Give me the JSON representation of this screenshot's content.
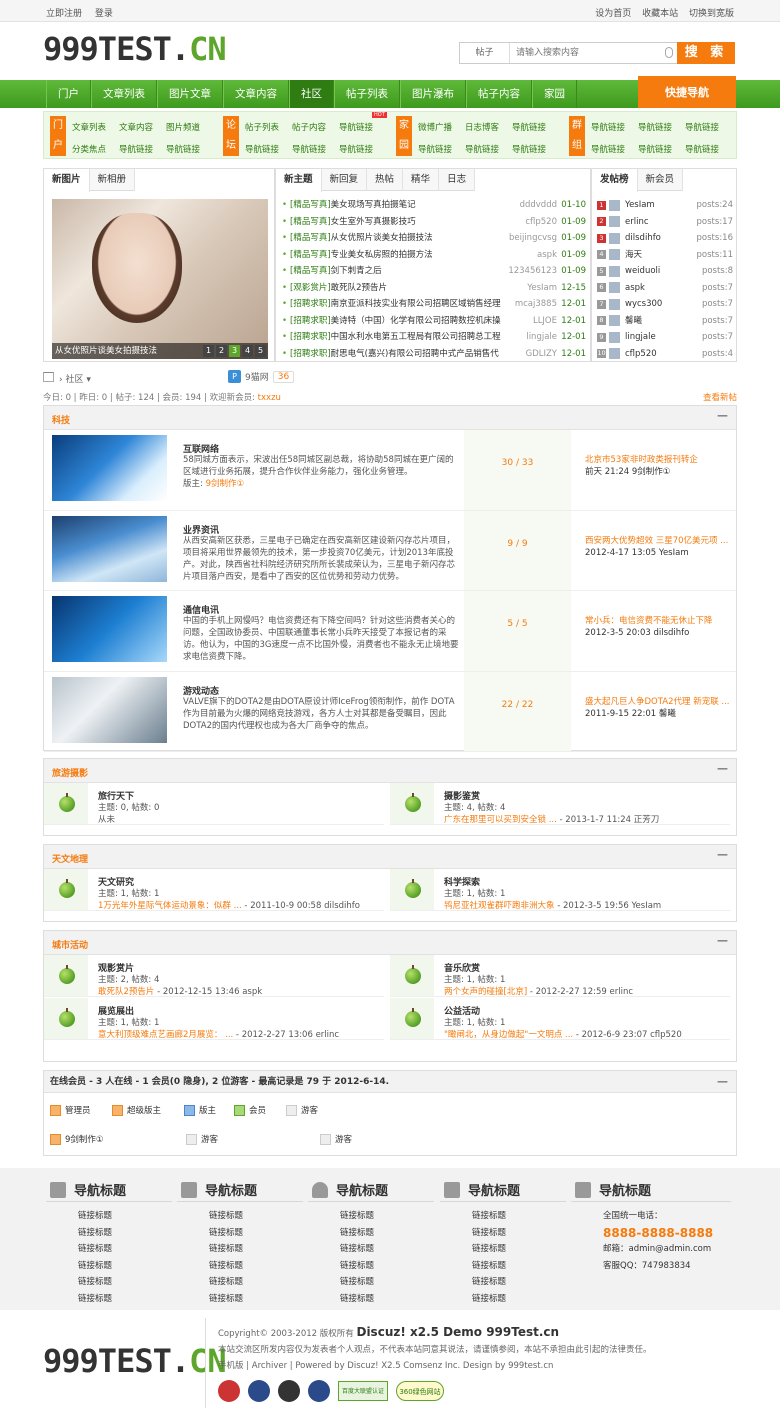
{
  "topbar": {
    "register": "立即注册",
    "login": "登录",
    "right": [
      "设为首页",
      "收藏本站",
      "切换到宽版"
    ]
  },
  "logo": {
    "text": "999TEST.",
    "suffix": "CN"
  },
  "search": {
    "select": "帖子",
    "placeholder": "请输入搜索内容",
    "button": "搜 索"
  },
  "nav": {
    "items": [
      "门户",
      "文章列表",
      "图片文章",
      "文章内容",
      "社区",
      "帖子列表",
      "图片瀑布",
      "帖子内容",
      "家园"
    ],
    "active": "社区",
    "quick": "快捷导航"
  },
  "subnav": [
    {
      "tag": "门户",
      "links": [
        "文章列表",
        "文章内容",
        "图片频道",
        "分类焦点",
        "导航链接",
        "导航链接"
      ]
    },
    {
      "tag": "论坛",
      "links": [
        "帖子列表",
        "帖子内容",
        "导航链接",
        "导航链接",
        "导航链接",
        "导航链接"
      ]
    },
    {
      "tag": "家园",
      "links": [
        "微博广播",
        "日志博客",
        "导航链接",
        "导航链接",
        "导航链接",
        "导航链接"
      ]
    },
    {
      "tag": "群组",
      "links": [
        "导航链接",
        "导航链接",
        "导航链接",
        "导航链接",
        "导航链接",
        "导航链接"
      ]
    }
  ],
  "hot": "HOT",
  "panel1": {
    "tabs": [
      "新图片",
      "新相册"
    ],
    "caption": "从女优照片谈美女拍摄技法",
    "nums": [
      "1",
      "2",
      "3",
      "4",
      "5"
    ]
  },
  "panel2": {
    "tabs": [
      "新主题",
      "新回复",
      "热帖",
      "精华",
      "日志"
    ],
    "topics": [
      {
        "cat": "[精品写真]",
        "title": "美女现场写真拍摄笔记",
        "author": "dddvddd",
        "date": "01-10"
      },
      {
        "cat": "[精品写真]",
        "title": "女生室外写真摄影技巧",
        "author": "cflp520",
        "date": "01-09"
      },
      {
        "cat": "[精品写真]",
        "title": "从女优照片谈美女拍摄技法",
        "author": "beijingcvsg",
        "date": "01-09"
      },
      {
        "cat": "[精品写真]",
        "title": "专业美女私房照的拍摄方法",
        "author": "aspk",
        "date": "01-09"
      },
      {
        "cat": "[精品写真]",
        "title": "剑下刺青之后",
        "author": "123456123",
        "date": "01-09"
      },
      {
        "cat": "[观影赏片]",
        "title": "敢死队2预告片",
        "author": "YesIam",
        "date": "12-15"
      },
      {
        "cat": "[招聘求职]",
        "title": "南京亚派科技实业有限公司招聘区域销售经理",
        "author": "mcaj3885",
        "date": "12-01"
      },
      {
        "cat": "[招聘求职]",
        "title": "美诗特（中国）化学有限公司招聘数控机床操",
        "author": "LLJOE",
        "date": "12-01"
      },
      {
        "cat": "[招聘求职]",
        "title": "中国水利水电第五工程局有限公司招聘总工程",
        "author": "lingjale",
        "date": "12-01"
      },
      {
        "cat": "[招聘求职]",
        "title": "耐思电气(嘉兴)有限公司招聘中式产品销售代",
        "author": "GDLIZY",
        "date": "12-01"
      }
    ]
  },
  "panel3": {
    "tabs": [
      "发帖榜",
      "新会员"
    ],
    "rank": [
      {
        "no": "1",
        "name": "YesIam",
        "posts": "posts:24"
      },
      {
        "no": "2",
        "name": "erlinc",
        "posts": "posts:17"
      },
      {
        "no": "3",
        "name": "dilsdihfo",
        "posts": "posts:16"
      },
      {
        "no": "4",
        "name": "海天",
        "posts": "posts:11"
      },
      {
        "no": "5",
        "name": "weiduoli",
        "posts": "posts:8"
      },
      {
        "no": "6",
        "name": "aspk",
        "posts": "posts:7"
      },
      {
        "no": "7",
        "name": "wycs300",
        "posts": "posts:7"
      },
      {
        "no": "8",
        "name": "馨曦",
        "posts": "posts:7"
      },
      {
        "no": "9",
        "name": "lingjale",
        "posts": "posts:7"
      },
      {
        "no": "10",
        "name": "cflp520",
        "posts": "posts:4"
      }
    ]
  },
  "crumb": {
    "path": "› 社区 ▾",
    "site": "9猫网",
    "count": "36"
  },
  "stats": {
    "text": "今日: 0 | 昨日: 0 | 帖子: 124 | 会员: 194 | 欢迎新会员: ",
    "user": "txxzu",
    "newpost": "查看新帖"
  },
  "sec1": {
    "title": "科技",
    "rows": [
      {
        "name": "互联网络",
        "desc": "58同城方面表示，宋波出任58同城区副总裁，将协助58同城在更广阔的区域进行业务拓展，提升合作伙伴业务能力，强化业务管理。",
        "mod": "版主: ",
        "modname": "9剑制作①",
        "count": "30 / 33",
        "lasttitle": "北京市53家非时政类报刊转企",
        "lastinfo": "前天 21:24 9剑制作①"
      },
      {
        "name": "业界资讯",
        "desc": "从西安高新区获悉，三星电子已确定在西安高新区建设新闪存芯片项目，项目将采用世界最领先的技术，第一步投资70亿美元，计划2013年底投产。对此，陕西省社科院经济研究所所长裴成荣认为，三星电子新闪存芯片项目落户西安，是看中了西安的区位优势和劳动力优势。",
        "mod": "",
        "modname": "",
        "count": "9 / 9",
        "lasttitle": "西安两大优势超效 三星70亿美元项 ...",
        "lastinfo": "2012-4-17 13:05 YesIam"
      },
      {
        "name": "通信电讯",
        "desc": "中国的手机上网慢吗？电信资费还有下降空间吗？针对这些消费者关心的问题，全国政协委员、中国联通董事长常小兵昨天接受了本报记者的采访。他认为，中国的3G速度一点不比国外慢，消费者也不能永无止境地要求电信资费下降。",
        "mod": "",
        "modname": "",
        "count": "5 / 5",
        "lasttitle": "常小兵：电信资费不能无休止下降",
        "lastinfo": "2012-3-5 20:03 dilsdihfo"
      },
      {
        "name": "游戏动态",
        "desc": "VALVE旗下的DOTA2是由DOTA原设计师IceFrog领衔制作，前作 DOTA作为目前最为火爆的网络竞技游戏，各方人士对其都是备受瞩目，因此DOTA2的国内代理权也成为各大厂商争夺的焦点。",
        "mod": "",
        "modname": "",
        "count": "22 / 22",
        "lasttitle": "盛大起凡巨人争DOTA2代理 新宠联 ...",
        "lastinfo": "2011-9-15 22:01 馨曦"
      }
    ]
  },
  "sec2": {
    "title": "旅游摄影",
    "cards": [
      {
        "name": "旅行天下",
        "stat": "主题: 0, 帖数: 0",
        "lasttitle": "",
        "lastinfo": "从未"
      },
      {
        "name": "摄影鉴赏",
        "stat": "主题: 4, 帖数: 4",
        "lasttitle": "广东在那里可以买到安全锁 ...",
        "lastinfo": " - 2013-1-7 11:24 正芳刀"
      }
    ]
  },
  "sec3": {
    "title": "天文地理",
    "cards": [
      {
        "name": "天文研究",
        "stat": "主题: 1, 帖数: 1",
        "lasttitle": "1万光年外星际气体运动景象：似群 ...",
        "lastinfo": " - 2011-10-9 00:58 dilsdihfo"
      },
      {
        "name": "科学探索",
        "stat": "主题: 1, 帖数: 1",
        "lasttitle": "鸨尼亚社观雀群吓跑非洲大象",
        "lastinfo": " - 2012-3-5 19:56 YesIam"
      }
    ]
  },
  "sec4": {
    "title": "城市活动",
    "cards": [
      {
        "name": "观影赏片",
        "stat": "主题: 2, 帖数: 4",
        "lasttitle": "敢死队2预告片",
        "lastinfo": " - 2012-12-15 13:46 aspk"
      },
      {
        "name": "音乐欣赏",
        "stat": "主题: 1, 帖数: 1",
        "lasttitle": "两个女声的碰撞[北京]",
        "lastinfo": " - 2012-2-27 12:59 erlinc"
      },
      {
        "name": "展览展出",
        "stat": "主题: 1, 帖数: 1",
        "lasttitle": "意大利顶级难点艺画廊2月展览： ...",
        "lastinfo": " - 2012-2-27 13:06 erlinc"
      },
      {
        "name": "公益活动",
        "stat": "主题: 1, 帖数: 1",
        "lasttitle": "\"瞰闸北，从身边做起\"一文明点 ...",
        "lastinfo": " - 2012-6-9 23:07 cflp520"
      }
    ]
  },
  "online": {
    "title": "在线会员 - 3 人在线 - 1 会员(0 隐身), 2 位游客 - 最高记录是 79 于 2012-6-14.",
    "legend": [
      "管理员",
      "超级版主",
      "版主",
      "会员",
      "游客"
    ],
    "users": [
      "9剑制作①",
      "游客",
      "游客"
    ]
  },
  "footnav": [
    {
      "title": "导航标题",
      "links": [
        "链接标题",
        "链接标题",
        "链接标题",
        "链接标题",
        "链接标题",
        "链接标题"
      ]
    },
    {
      "title": "导航标题",
      "links": [
        "链接标题",
        "链接标题",
        "链接标题",
        "链接标题",
        "链接标题",
        "链接标题"
      ]
    },
    {
      "title": "导航标题",
      "links": [
        "链接标题",
        "链接标题",
        "链接标题",
        "链接标题",
        "链接标题",
        "链接标题"
      ]
    },
    {
      "title": "导航标题",
      "links": [
        "链接标题",
        "链接标题",
        "链接标题",
        "链接标题",
        "链接标题",
        "链接标题"
      ]
    },
    {
      "title": "导航标题",
      "links": [
        "全国统一电话：",
        "8888-8888-8888",
        "邮箱：admin@admin.com",
        "客服QQ：747983834"
      ]
    }
  ],
  "copyright": {
    "line1": "Copyright© 2003-2012 版权所有",
    "brand": "Discuz! x2.5 Demo 999Test.cn",
    "line2": "本站交流区所发内容仅为发表者个人观点，不代表本站同意其说法，请谨慎参阅，本站不承担由此引起的法律责任。",
    "line3": "手机版 | Archiver | Powered by Discuz! X2.5 Comsenz Inc. Design by 999test.cn",
    "badge1": "百度大联盟认证",
    "badge2": "360绿色网站"
  }
}
